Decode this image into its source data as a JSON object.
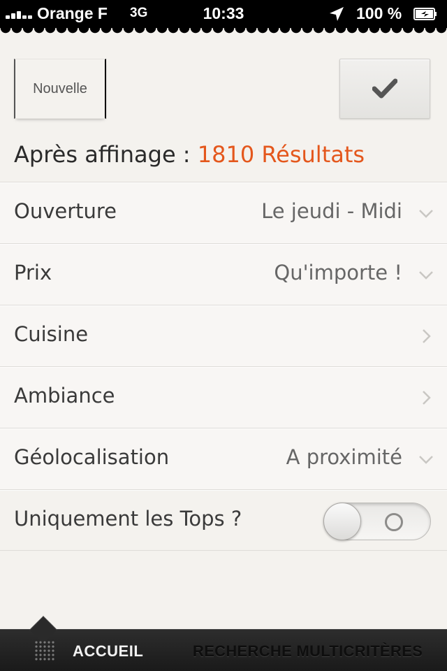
{
  "status_bar": {
    "carrier": "Orange F",
    "network": "3G",
    "time": "10:33",
    "battery": "100 %"
  },
  "top": {
    "new_label": "Nouvelle",
    "validate_icon": "checkmark-icon"
  },
  "results": {
    "prefix": "Après affinage :",
    "count_text": "1810 Résultats",
    "accent_color": "#e4571c"
  },
  "filters": [
    {
      "label": "Ouverture",
      "value": "Le jeudi - Midi",
      "icon": "chevron-down-icon"
    },
    {
      "label": "Prix",
      "value": "Qu'importe !",
      "icon": "chevron-down-icon"
    },
    {
      "label": "Cuisine",
      "value": "",
      "icon": "chevron-right-icon"
    },
    {
      "label": "Ambiance",
      "value": "",
      "icon": "chevron-right-icon"
    },
    {
      "label": "Géolocalisation",
      "value": "A proximité",
      "icon": "chevron-down-icon"
    }
  ],
  "tops": {
    "label": "Uniquement les Tops ?",
    "enabled": false
  },
  "tabbar": {
    "home": "ACCUEIL",
    "search": "RECHERCHE MULTICRITÈRES"
  }
}
